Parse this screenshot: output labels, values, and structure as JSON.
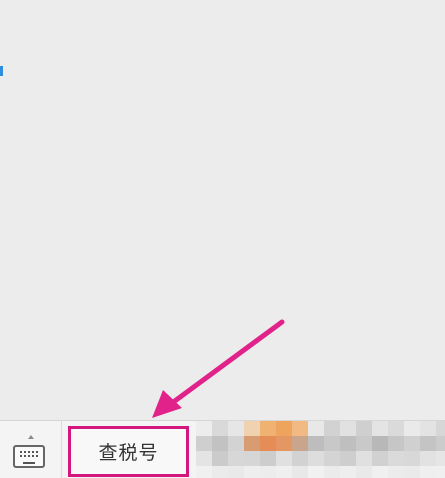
{
  "menu": {
    "item_label": "查税号"
  },
  "colors": {
    "highlight_box": "#d4177f",
    "arrow": "#e0228a",
    "background": "#ececec"
  },
  "icons": {
    "keyboard": "keyboard-icon"
  }
}
